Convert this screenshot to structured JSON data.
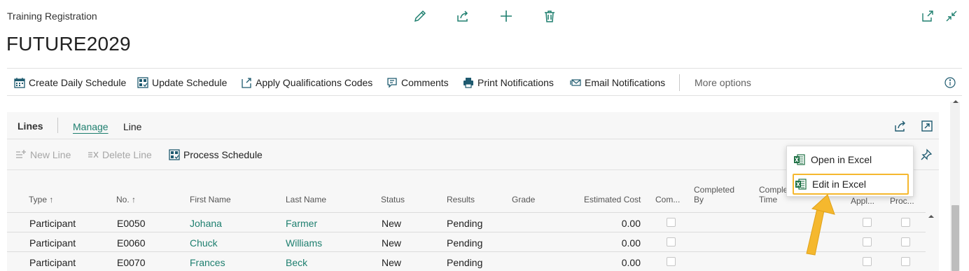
{
  "header": {
    "breadcrumb": "Training Registration",
    "title": "FUTURE2029",
    "icons": [
      "edit-icon",
      "share-icon",
      "new-icon",
      "delete-icon",
      "open-new-window-icon",
      "collapse-icon"
    ]
  },
  "actions": {
    "create_daily_schedule": "Create Daily Schedule",
    "update_schedule": "Update Schedule",
    "apply_qualification_codes": "Apply Qualifications Codes",
    "comments": "Comments",
    "print_notifications": "Print Notifications",
    "email_notifications": "Email Notifications",
    "more_options": "More options"
  },
  "lines": {
    "title": "Lines",
    "tabs": {
      "manage": "Manage",
      "line": "Line"
    },
    "subactions": {
      "new_line": "New Line",
      "delete_line": "Delete Line",
      "process_schedule": "Process Schedule"
    },
    "columns": {
      "type": "Type ↑",
      "no": "No. ↑",
      "first_name": "First Name",
      "last_name": "Last Name",
      "status": "Status",
      "results": "Results",
      "grade": "Grade",
      "estimated_cost": "Estimated Cost",
      "com": "Com...",
      "completed_by_1": "Completed",
      "completed_by_2": "By",
      "completed_time_1": "Comple",
      "completed_time_2": "Time",
      "appl": "Appl...",
      "proc": "Proc..."
    },
    "rows": [
      {
        "type": "Participant",
        "no": "E0050",
        "first_name": "Johana",
        "last_name": "Farmer",
        "status": "New",
        "results": "Pending",
        "estimated_cost": "0.00"
      },
      {
        "type": "Participant",
        "no": "E0060",
        "first_name": "Chuck",
        "last_name": "Williams",
        "status": "New",
        "results": "Pending",
        "estimated_cost": "0.00"
      },
      {
        "type": "Participant",
        "no": "E0070",
        "first_name": "Frances",
        "last_name": "Beck",
        "status": "New",
        "results": "Pending",
        "estimated_cost": "0.00"
      }
    ]
  },
  "excel_menu": {
    "open_in_excel": "Open in Excel",
    "edit_in_excel": "Edit in Excel"
  },
  "colors": {
    "accent": "#1e7f6f",
    "highlight": "#f5b82e",
    "arrow": "#f5b82e"
  }
}
